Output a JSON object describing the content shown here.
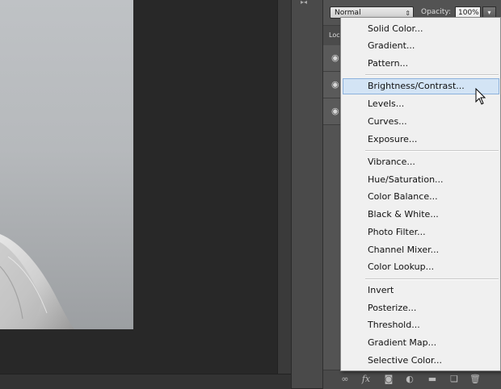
{
  "layers_panel": {
    "blend_mode": "Normal",
    "opacity_label": "Opacity:",
    "opacity_value": "100%",
    "lock_label": "Loc"
  },
  "adjustment_menu": {
    "items": [
      "Solid Color...",
      "Gradient...",
      "Pattern...",
      "Brightness/Contrast...",
      "Levels...",
      "Curves...",
      "Exposure...",
      "Vibrance...",
      "Hue/Saturation...",
      "Color Balance...",
      "Black & White...",
      "Photo Filter...",
      "Channel Mixer...",
      "Color Lookup...",
      "Invert",
      "Posterize...",
      "Threshold...",
      "Gradient Map...",
      "Selective Color..."
    ],
    "highlighted": "Brightness/Contrast..."
  },
  "colors": {
    "workspace": "#282828",
    "panel": "#535353",
    "menu_bg": "#f0f0f0",
    "menu_highlight": "#d3e4f5",
    "menu_highlight_border": "#8cb1dc"
  },
  "icons": {
    "eye": "eye-icon",
    "link": "link-layers-icon",
    "fx": "fx-icon",
    "mask": "add-mask-icon",
    "adjustment": "adjustment-layer-icon",
    "folder": "group-folder-icon",
    "new_layer": "new-layer-icon",
    "trash": "delete-layer-icon"
  }
}
